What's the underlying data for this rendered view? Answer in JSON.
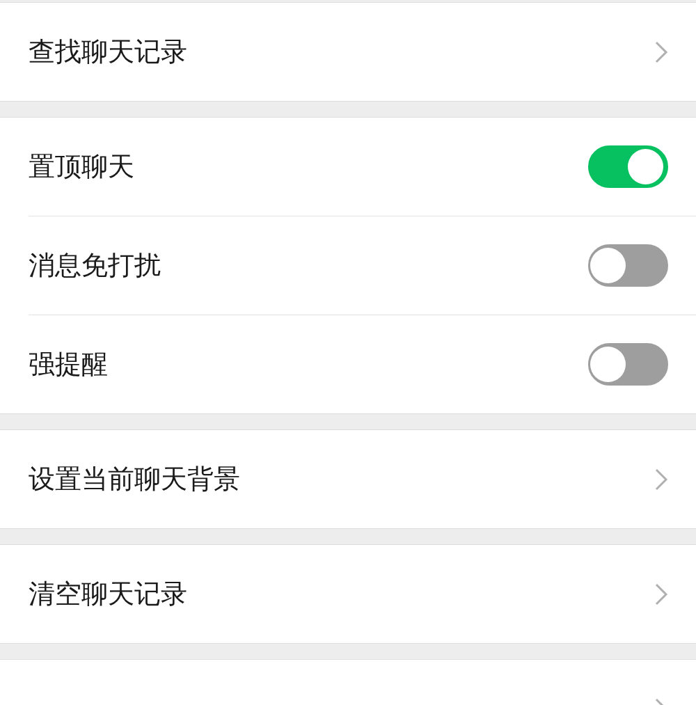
{
  "sections": [
    {
      "items": [
        {
          "kind": "link",
          "label": "查找聊天记录"
        }
      ]
    },
    {
      "items": [
        {
          "kind": "toggle",
          "label": "置顶聊天",
          "on": true
        },
        {
          "kind": "toggle",
          "label": "消息免打扰",
          "on": false
        },
        {
          "kind": "toggle",
          "label": "强提醒",
          "on": false
        }
      ]
    },
    {
      "items": [
        {
          "kind": "link",
          "label": "设置当前聊天背景"
        }
      ]
    },
    {
      "items": [
        {
          "kind": "link",
          "label": "清空聊天记录"
        }
      ]
    },
    {
      "items": [
        {
          "kind": "link"
        }
      ]
    }
  ]
}
